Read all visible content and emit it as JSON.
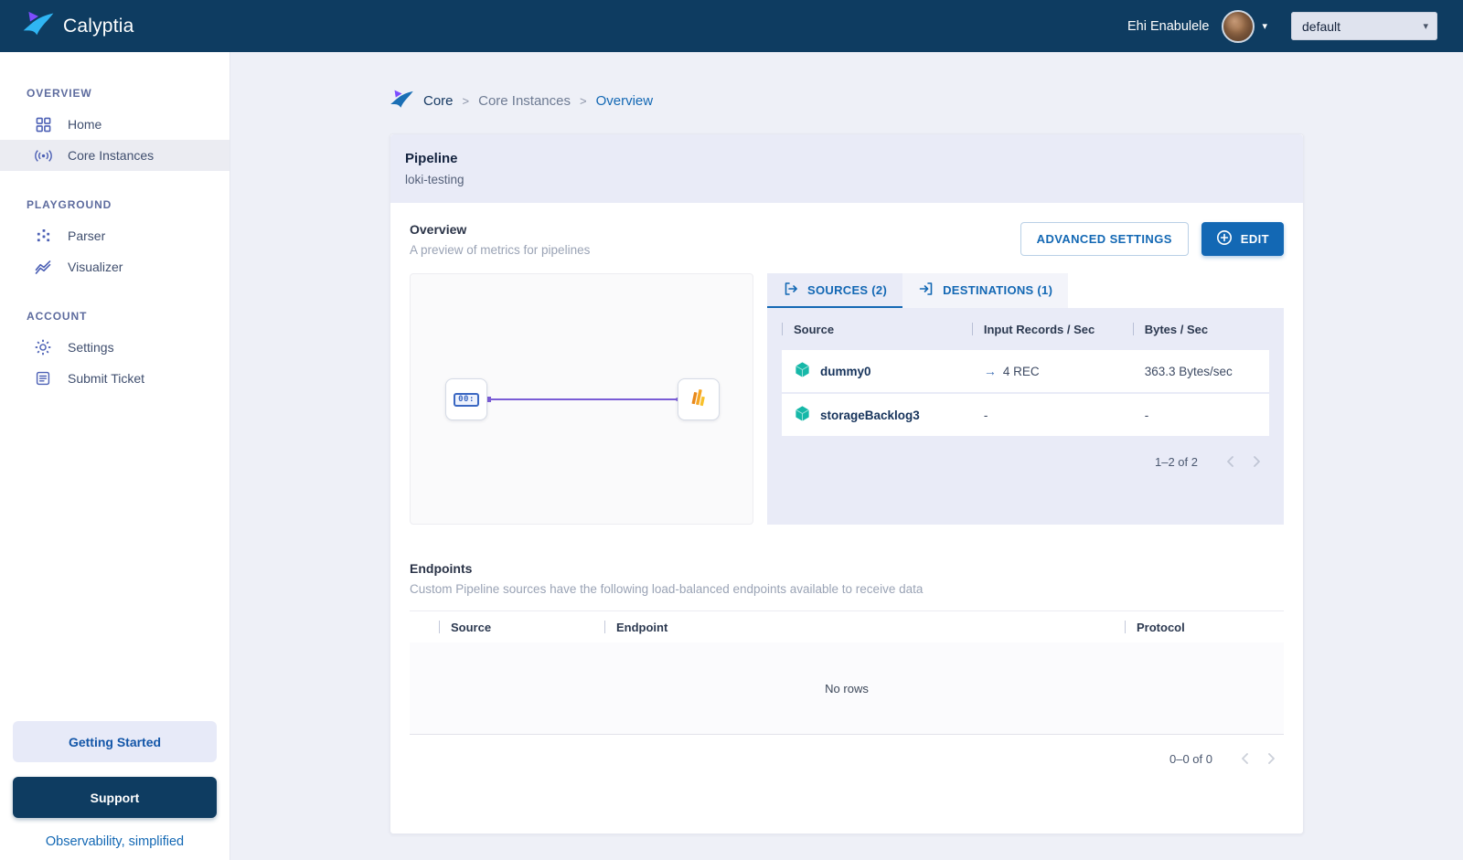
{
  "colors": {
    "navy": "#0e3c61",
    "accent_blue": "#1368b4",
    "lavender_panel": "#e9ebf7",
    "teal_icon": "#16b8a8",
    "edge_purple": "#7a5cd6"
  },
  "topbar": {
    "brand": "Calyptia",
    "user_name": "Ehi Enabulele",
    "user_caret": "▾",
    "workspace": {
      "value": "default",
      "caret": "▾"
    }
  },
  "sidebar": {
    "sections": [
      {
        "label": "OVERVIEW",
        "items": [
          {
            "label": "Home"
          },
          {
            "label": "Core Instances"
          }
        ]
      },
      {
        "label": "PLAYGROUND",
        "items": [
          {
            "label": "Parser"
          },
          {
            "label": "Visualizer"
          }
        ]
      },
      {
        "label": "ACCOUNT",
        "items": [
          {
            "label": "Settings"
          },
          {
            "label": "Submit Ticket"
          }
        ]
      }
    ],
    "getting_started": "Getting Started",
    "support": "Support",
    "tagline": "Observability, simplified"
  },
  "breadcrumb": {
    "separator": ">",
    "items": [
      "Core",
      "Core Instances",
      "Overview"
    ]
  },
  "pipeline": {
    "title": "Pipeline",
    "name": "loki-testing",
    "overview_title": "Overview",
    "overview_subtitle": "A preview of metrics for pipelines",
    "advanced_settings_label": "ADVANCED SETTINGS",
    "edit_label": "EDIT",
    "tabs": [
      {
        "label": "SOURCES (2)"
      },
      {
        "label": "DESTINATIONS (1)"
      }
    ],
    "sources_table": {
      "columns": [
        "Source",
        "Input Records / Sec",
        "Bytes / Sec"
      ],
      "rows": [
        {
          "name": "dummy0",
          "arrow": "→",
          "records": "4 REC",
          "bytes": "363.3 Bytes/sec"
        },
        {
          "name": "storageBacklog3",
          "arrow": "",
          "records": "-",
          "bytes": "-"
        }
      ],
      "pagination": "1–2 of 2"
    }
  },
  "endpoints": {
    "title": "Endpoints",
    "subtitle": "Custom Pipeline sources have the following load-balanced endpoints available to receive data",
    "columns": [
      "Source",
      "Endpoint",
      "Protocol"
    ],
    "empty_text": "No rows",
    "pagination": "0–0 of 0"
  }
}
